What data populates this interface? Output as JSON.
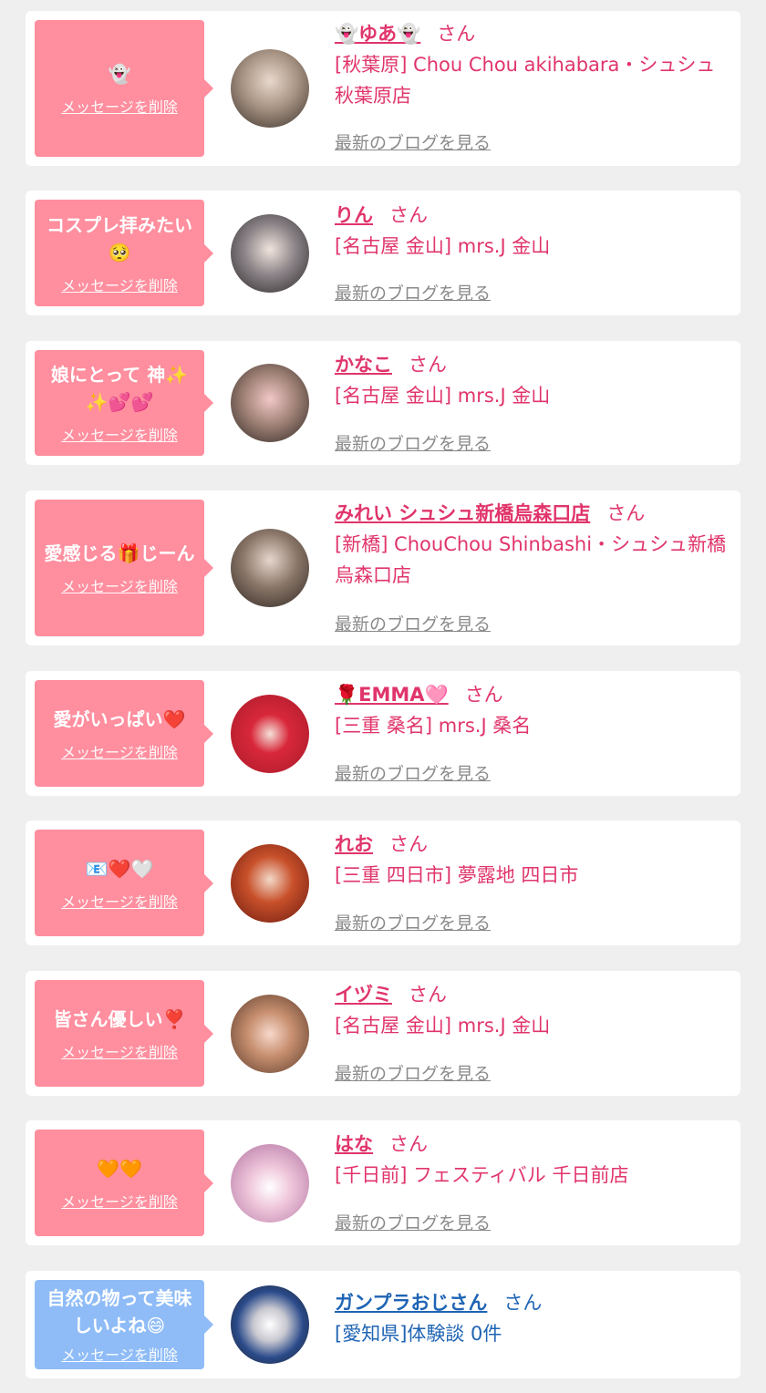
{
  "delete_label": "メッセージを削除",
  "san_label": "さん",
  "blog_label": "最新のブログを見る",
  "colors": {
    "bubble_pink": "#ff8e9e",
    "bubble_blue": "#8fbcf7",
    "name_pink": "#e0356b",
    "name_blue": "#1f64b4",
    "blog_gray": "#8a8a8a",
    "background": "#efefef"
  },
  "messages": [
    {
      "message": "👻",
      "name": "👻ゆあ👻",
      "shop": "[秋葉原] Chou Chou akihabara・シュシュ秋葉原店",
      "avatar": "avatar-photo"
    },
    {
      "message": "コスプレ拝みたい🥺",
      "name": "りん",
      "shop": "[名古屋 金山] mrs.J 金山",
      "avatar": "avatar-photo"
    },
    {
      "message": "娘にとって 神✨✨💕💕",
      "name": "かなこ",
      "shop": "[名古屋 金山] mrs.J 金山",
      "avatar": "avatar-photo"
    },
    {
      "message": "愛感じる🎁じーん",
      "name": "みれい シュシュ新橋烏森口店",
      "shop": "[新橋] ChouChou Shinbashi・シュシュ新橋烏森口店",
      "avatar": "avatar-photo"
    },
    {
      "message": "愛がいっぱい❤️",
      "name": "🌹EMMA🩷",
      "shop": "[三重 桑名] mrs.J 桑名",
      "avatar": "avatar-photo"
    },
    {
      "message": "📧❤️🤍",
      "name": "れお",
      "shop": "[三重 四日市] 夢露地 四日市",
      "avatar": "avatar-photo"
    },
    {
      "message": "皆さん優しい❣️",
      "name": "イヅミ",
      "shop": "[名古屋 金山] mrs.J 金山",
      "avatar": "avatar-photo"
    },
    {
      "message": "🧡🧡",
      "name": "はな",
      "shop": "[千日前] フェスティバル 千日前店",
      "avatar": "avatar-photo"
    },
    {
      "message": "自然の物って美味しいよね😄",
      "name": "ガンプラおじさん",
      "shop": "[愛知県]体験談 0件",
      "avatar": "avatar-photo"
    }
  ]
}
